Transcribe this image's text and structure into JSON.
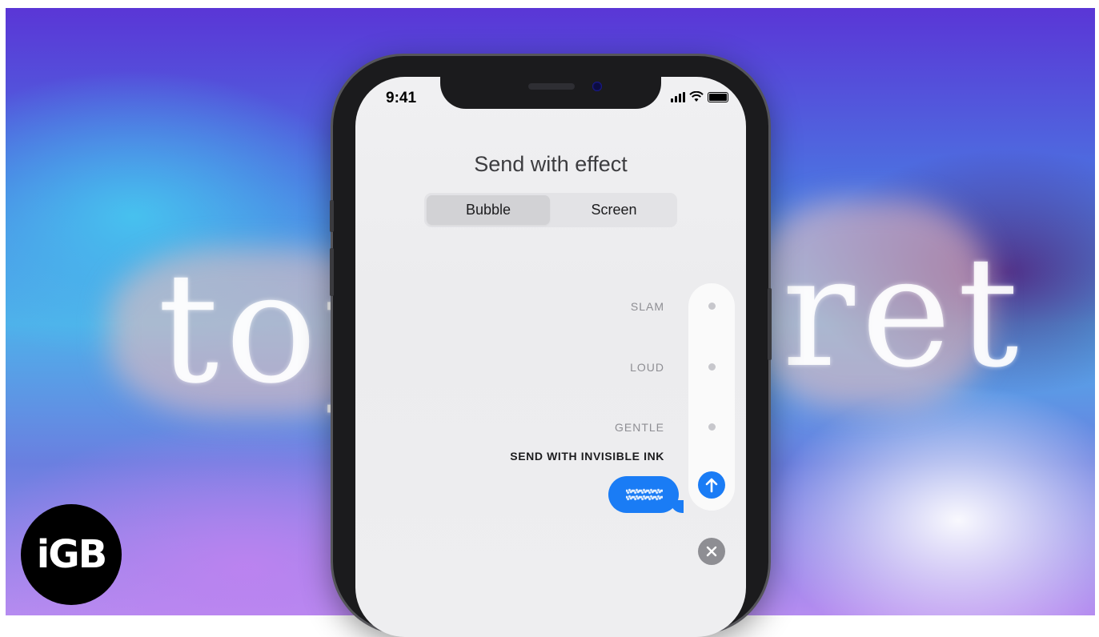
{
  "background": {
    "chalk_left": "top",
    "chalk_right": "ret"
  },
  "status_bar": {
    "time": "9:41",
    "signal_icon": "cellular-bars-icon",
    "wifi_icon": "wifi-icon",
    "battery_icon": "battery-icon"
  },
  "sheet": {
    "title": "Send with effect",
    "tabs": [
      {
        "label": "Bubble",
        "selected": true
      },
      {
        "label": "Screen",
        "selected": false
      }
    ]
  },
  "effects": [
    {
      "label": "SLAM",
      "selected": false
    },
    {
      "label": "LOUD",
      "selected": false
    },
    {
      "label": "GENTLE",
      "selected": false
    },
    {
      "label": "SEND WITH INVISIBLE INK",
      "selected": true
    }
  ],
  "colors": {
    "accent": "#1a7cf5",
    "close": "#8e8e93"
  },
  "logo": {
    "text": "iGB"
  }
}
